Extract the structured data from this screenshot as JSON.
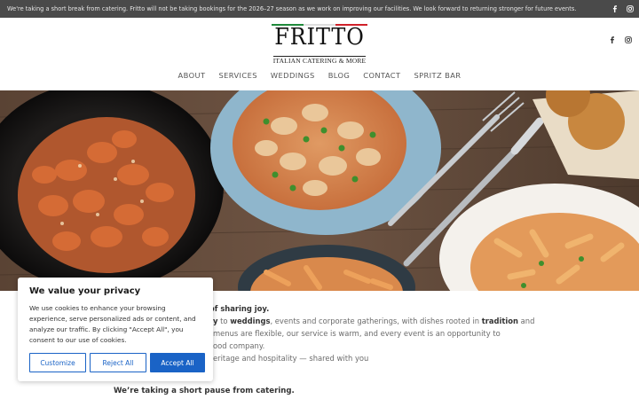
{
  "announcement": {
    "text": "We're taking a short break from catering. Fritto will not be taking bookings for the 2026–27 season as we work on improving our facilities. We look forward to returning stronger for future events."
  },
  "social": {
    "icons": [
      "facebook-icon",
      "instagram-icon"
    ]
  },
  "brand": {
    "name": "FRITTO",
    "tagline": "ITALIAN CATERING & MORE",
    "flag_colors": [
      "#1f8a3a",
      "#ffffff",
      "#d0212a"
    ]
  },
  "nav": {
    "items": [
      "ABOUT",
      "SERVICES",
      "WEDDINGS",
      "BLOG",
      "CONTACT",
      "SPRITZ BAR"
    ]
  },
  "intro": {
    "line1_end": "of sharing joy.",
    "line2_pre": "y",
    "line2_to": " to ",
    "line2_weddings": "weddings",
    "line2_mid": ", events and corporate gatherings, with dishes rooted in ",
    "line2_tradition": "tradition",
    "line2_end": " and",
    "line3": "menus are flexible, our service is warm, and every event is an opportunity to",
    "line4": "ood company.",
    "line5": "eritage and hospitality — shared with you",
    "pause": "We’re taking a short pause from catering."
  },
  "cookie": {
    "title": "We value your privacy",
    "body": "We use cookies to enhance your browsing experience, serve personalized ads or content, and analyze our traffic. By clicking \"Accept All\", you consent to our use of cookies.",
    "customize": "Customize",
    "reject": "Reject All",
    "accept": "Accept All"
  },
  "colors": {
    "accent": "#1a63c6",
    "topbar": "#4a4a4a"
  }
}
